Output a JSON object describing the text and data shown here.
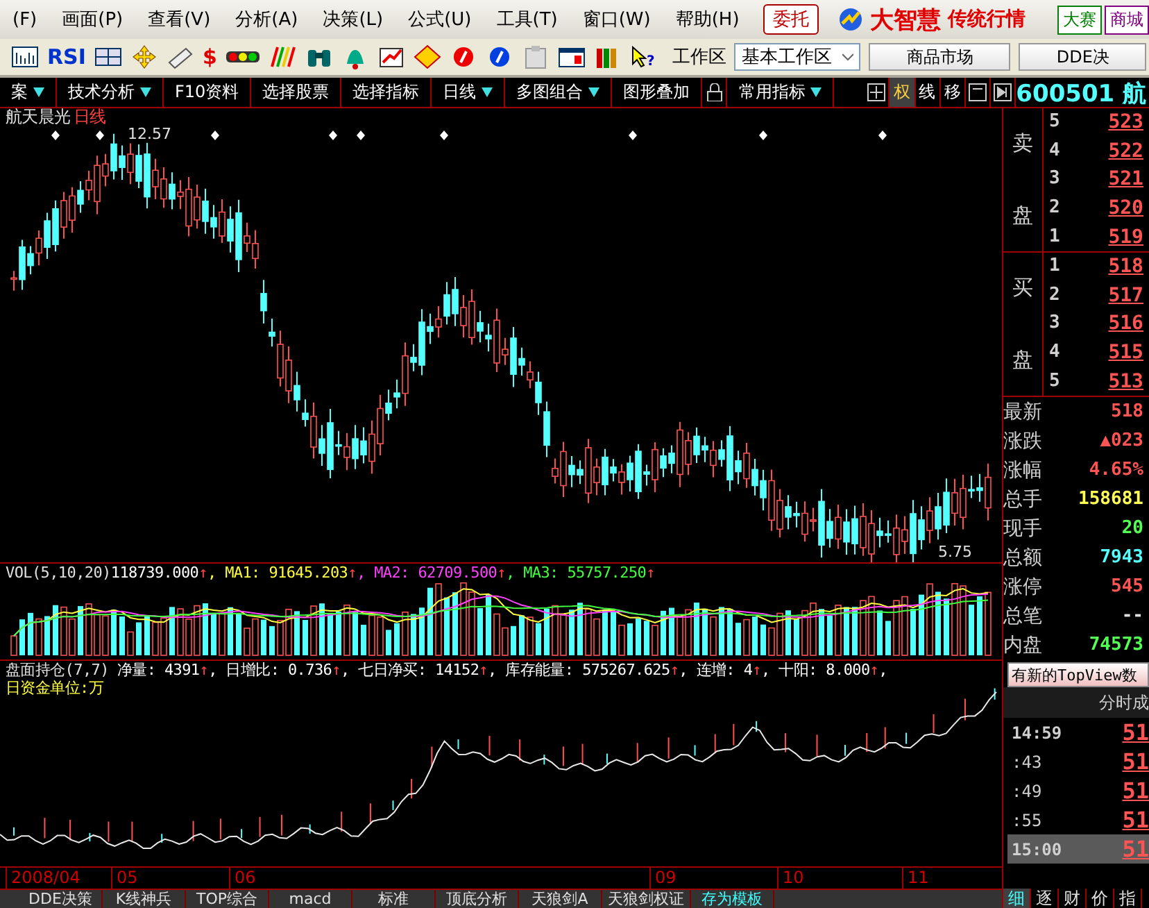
{
  "menu": [
    "(F)",
    "画面(P)",
    "查看(V)",
    "分析(A)",
    "决策(L)",
    "公式(U)",
    "工具(T)",
    "窗口(W)",
    "帮助(H)"
  ],
  "trade_button": "委托",
  "logo": {
    "brand": "大智慧",
    "tagline": "传统行情"
  },
  "top_links": [
    "大赛",
    "商城"
  ],
  "tools": [
    {
      "kind": "bars"
    },
    {
      "kind": "text",
      "label": "RSI"
    },
    {
      "kind": "grid"
    },
    {
      "kind": "move"
    },
    {
      "kind": "ruler"
    },
    {
      "kind": "dollar",
      "label": "$"
    },
    {
      "kind": "lights"
    },
    {
      "kind": "stripes"
    },
    {
      "kind": "binoculars"
    },
    {
      "kind": "bell"
    },
    {
      "kind": "trend"
    },
    {
      "kind": "diamond"
    },
    {
      "kind": "redcoin"
    },
    {
      "kind": "bluecoin"
    },
    {
      "kind": "clipboard"
    },
    {
      "kind": "window"
    },
    {
      "kind": "books"
    },
    {
      "kind": "help",
      "label": "?"
    }
  ],
  "workspace": {
    "label": "工作区",
    "value": "基本工作区"
  },
  "market_tabs": [
    {
      "label": "商品市场",
      "selected": false
    },
    {
      "label": "DDE决",
      "selected": false
    }
  ],
  "tabs": [
    {
      "label": "案",
      "dropdown": true
    },
    {
      "label": "技术分析",
      "dropdown": true
    },
    {
      "label": "F10资料",
      "dropdown": false
    },
    {
      "label": "选择股票",
      "dropdown": false
    },
    {
      "label": "选择指标",
      "dropdown": false
    },
    {
      "label": "日线",
      "dropdown": true
    },
    {
      "label": "多图组合",
      "dropdown": true
    },
    {
      "label": "图形叠加",
      "dropdown": false
    },
    {
      "label": "常用指标",
      "dropdown": true
    }
  ],
  "view_tabs": [
    {
      "label": "权",
      "selected": true
    },
    {
      "label": "线",
      "selected": false
    },
    {
      "label": "移",
      "selected": false
    }
  ],
  "stock_code": "600501 航",
  "chart": {
    "name": "航天晨光",
    "period": "日线",
    "high": "12.57",
    "low": "5.75"
  },
  "vol_legend": [
    {
      "text": "VOL(5,10,20)",
      "color": "#e0e0e0"
    },
    {
      "text": "118739.000",
      "color": "#ffffff",
      "arrow": "↑"
    },
    {
      "text": ", MA1: 91645.203",
      "color": "#ffff40",
      "arrow": "↑"
    },
    {
      "text": ", MA2: 62709.500",
      "color": "#ff40ff",
      "arrow": "↑"
    },
    {
      "text": ", MA3: 55757.250",
      "color": "#40ff40",
      "arrow": "↑"
    }
  ],
  "position_legend": {
    "title": "盘面持仓(7,7)",
    "items": [
      {
        "text": "净量: 4391",
        "arrow": "↑"
      },
      {
        "text": ", 日增比: 0.736",
        "arrow": "↑"
      },
      {
        "text": ", 七日净买: 14152",
        "arrow": "↑"
      },
      {
        "text": ", 库存能量: 575267.625",
        "arrow": "↑"
      },
      {
        "text": ", 连增: 4",
        "arrow": "↑"
      },
      {
        "text": ", 十阳: 8.000",
        "arrow": "↑"
      },
      {
        "text": ","
      }
    ],
    "unit": "日资金单位:万"
  },
  "dates": [
    "2008/04",
    "05",
    "06",
    "09",
    "10",
    "11"
  ],
  "bottom_tabs": [
    {
      "label": "DDE决策",
      "kind": "tab"
    },
    {
      "label": "K线神兵",
      "kind": "tab"
    },
    {
      "label": "TOP综合",
      "kind": "tab"
    },
    {
      "label": "macd",
      "kind": "tab"
    },
    {
      "label": "标准",
      "kind": "tab"
    },
    {
      "label": "顶底分析",
      "kind": "tab"
    },
    {
      "label": "天狼剑A",
      "kind": "tab"
    },
    {
      "label": "天狼剑权证",
      "kind": "tab"
    },
    {
      "label": "存为模板",
      "kind": "action"
    }
  ],
  "sell": {
    "label": [
      "卖",
      "盘"
    ],
    "rows": [
      {
        "level": "5",
        "price": "523"
      },
      {
        "level": "4",
        "price": "522"
      },
      {
        "level": "3",
        "price": "521"
      },
      {
        "level": "2",
        "price": "520"
      },
      {
        "level": "1",
        "price": "519"
      }
    ]
  },
  "buy": {
    "label": [
      "买",
      "盘"
    ],
    "rows": [
      {
        "level": "1",
        "price": "518"
      },
      {
        "level": "2",
        "price": "517"
      },
      {
        "level": "3",
        "price": "516"
      },
      {
        "level": "4",
        "price": "515"
      },
      {
        "level": "5",
        "price": "513"
      }
    ]
  },
  "stats": [
    {
      "label": "最新",
      "value": "518",
      "color": "#ff5454"
    },
    {
      "label": "涨跌",
      "value": "▲023",
      "color": "#ff5454"
    },
    {
      "label": "涨幅",
      "value": "4.65%",
      "color": "#ff5454"
    },
    {
      "label": "总手",
      "value": "158681",
      "color": "#ffff54"
    },
    {
      "label": "现手",
      "value": "20",
      "color": "#54ff54"
    },
    {
      "label": "总额",
      "value": "7943",
      "color": "#54ffff"
    },
    {
      "label": "涨停",
      "value": "545",
      "color": "#ff5454"
    },
    {
      "label": "总笔",
      "value": "--",
      "color": "#e0e0e0"
    },
    {
      "label": "内盘",
      "value": "74573",
      "color": "#54ff54"
    }
  ],
  "topview_button": "有新的TopView数",
  "ticks_header": "分时成",
  "ticks": [
    {
      "time": "14:59",
      "price": "51",
      "selected": false
    },
    {
      "time": ":43",
      "price": "51",
      "selected": false
    },
    {
      "time": ":49",
      "price": "51",
      "selected": false
    },
    {
      "time": ":55",
      "price": "51",
      "selected": false
    },
    {
      "time": "15:00",
      "price": "51",
      "selected": true
    }
  ],
  "side_tabs": [
    {
      "label": "细",
      "selected": true
    },
    {
      "label": "逐",
      "selected": false
    },
    {
      "label": "财",
      "selected": false
    },
    {
      "label": "价",
      "selected": false
    },
    {
      "label": "指",
      "selected": false
    }
  ]
}
